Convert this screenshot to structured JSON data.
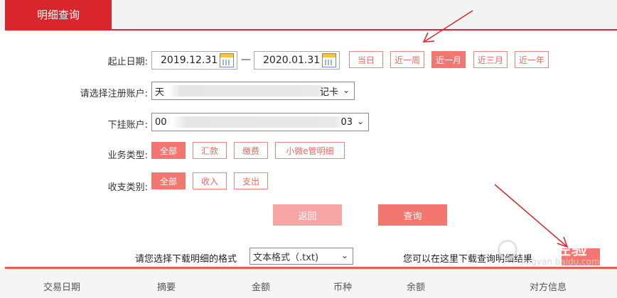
{
  "tab": {
    "label": "明细查询"
  },
  "form": {
    "date": {
      "label": "起止日期:",
      "start": "2019.12.31",
      "end": "2020.01.31",
      "separator": "—",
      "ranges": [
        {
          "label": "当日",
          "active": false
        },
        {
          "label": "近一周",
          "active": false
        },
        {
          "label": "近一月",
          "active": true
        },
        {
          "label": "近三月",
          "active": false
        },
        {
          "label": "近一年",
          "active": false
        }
      ]
    },
    "account": {
      "label": "请选择注册账户:",
      "value_start": "天",
      "value_end": "记卡"
    },
    "sub_account": {
      "label": "下挂账户:",
      "value_start": "00",
      "value_end": "03"
    },
    "business_type": {
      "label": "业务类型:",
      "options": [
        {
          "label": "全部",
          "active": true
        },
        {
          "label": "汇款",
          "active": false
        },
        {
          "label": "缴费",
          "active": false
        },
        {
          "label": "小微e管明细",
          "active": false
        }
      ]
    },
    "income_type": {
      "label": "收支类别:",
      "options": [
        {
          "label": "全部",
          "active": true
        },
        {
          "label": "收入",
          "active": false
        },
        {
          "label": "支出",
          "active": false
        }
      ]
    },
    "buttons": {
      "back": "返回",
      "query": "查询"
    }
  },
  "download": {
    "label": "请您选择下载明细的格式",
    "format": "文本格式（.txt)",
    "hint": "您可以在这里下载查询明细结果"
  },
  "table": {
    "columns": [
      "交易日期",
      "摘要",
      "金额",
      "币种",
      "余额",
      "对方信息"
    ]
  },
  "watermark": {
    "main": "Bai 经验",
    "sub": "jingyan.baidu.com"
  },
  "colors": {
    "brand_red": "#d8262c",
    "accent_salmon": "#f47670",
    "arrow": "#d8262c"
  }
}
